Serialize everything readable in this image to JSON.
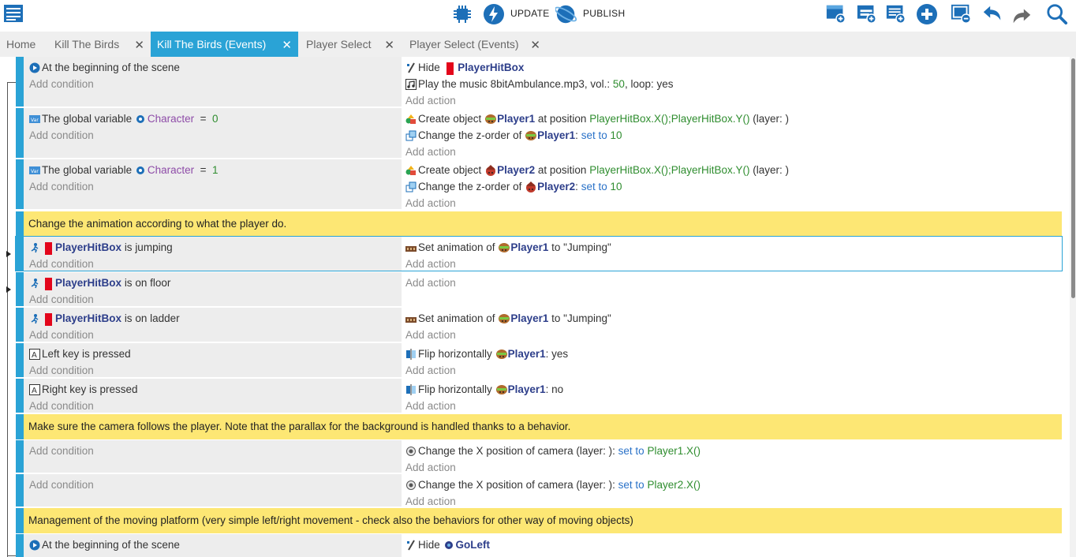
{
  "toolbar": {
    "update_label": "UPDATE",
    "publish_label": "PUBLISH"
  },
  "tabs": [
    {
      "label": "Home"
    },
    {
      "label": "Kill The Birds"
    },
    {
      "label": "Kill The Birds (Events)"
    },
    {
      "label": "Player Select"
    },
    {
      "label": "Player Select (Events)"
    }
  ],
  "tab_close": "✕",
  "colors": {
    "accent": "#2aa3d6",
    "comment_bg": "#fde774",
    "condition_bg": "#ededed",
    "object_text": "#2d3e8a",
    "value_text": "#2f8d2f"
  },
  "common": {
    "add_condition": "Add condition",
    "add_action": "Add action"
  },
  "events": {
    "e1": {
      "cond": "At the beginning of the scene",
      "a1_verb": "Hide",
      "a1_obj": "PlayerHitBox",
      "a2_pre": "Play the music",
      "a2_file": "8bitAmbulance.mp3, vol.:",
      "a2_vol": "50",
      "a2_post": ", loop: yes"
    },
    "e2": {
      "cond_pre": "The global variable",
      "cond_var": "Character",
      "cond_op": "=",
      "cond_val": "0",
      "a1_pre": "Create object",
      "a1_obj": "Player1",
      "a1_mid": "at position",
      "a1_expr": "PlayerHitBox.X();PlayerHitBox.Y()",
      "a1_post": "(layer: )",
      "a2_pre": "Change the z-order of",
      "a2_obj": "Player1",
      "a2_colon": ":",
      "a2_op": "set to",
      "a2_val": "10"
    },
    "e3": {
      "cond_pre": "The global variable",
      "cond_var": "Character",
      "cond_op": "=",
      "cond_val": "1",
      "a1_pre": "Create object",
      "a1_obj": "Player2",
      "a1_mid": "at position",
      "a1_expr": "PlayerHitBox.X();PlayerHitBox.Y()",
      "a1_post": "(layer: )",
      "a2_pre": "Change the z-order of",
      "a2_obj": "Player2",
      "a2_colon": ":",
      "a2_op": "set to",
      "a2_val": "10"
    },
    "c1": "Change the animation according to what the player do.",
    "e4": {
      "cond_obj": "PlayerHitBox",
      "cond_post": "is jumping",
      "a1_pre": "Set animation of",
      "a1_obj": "Player1",
      "a1_post": "to \"Jumping\""
    },
    "e5": {
      "cond_obj": "PlayerHitBox",
      "cond_post": "is on floor"
    },
    "e6": {
      "cond_obj": "PlayerHitBox",
      "cond_post": "is on ladder",
      "a1_pre": "Set animation of",
      "a1_obj": "Player1",
      "a1_post": "to \"Jumping\""
    },
    "e7": {
      "cond_key": "Left",
      "cond_post": "key is pressed",
      "a1_pre": "Flip horizontally",
      "a1_obj": "Player1",
      "a1_post": ": yes"
    },
    "e8": {
      "cond_key": "Right",
      "cond_post": "key is pressed",
      "a1_pre": "Flip horizontally",
      "a1_obj": "Player1",
      "a1_post": ": no"
    },
    "c2": "Make sure the camera follows the player. Note that the parallax for the background is handled thanks to a behavior.",
    "e9": {
      "a1_pre": "Change the X position of camera  (layer: ):",
      "a1_op": "set to",
      "a1_expr": "Player1.X()"
    },
    "e10": {
      "a1_pre": "Change the X position of camera  (layer: ):",
      "a1_op": "set to",
      "a1_expr": "Player2.X()"
    },
    "c3": "Management of the moving platform (very simple left/right movement - check also the behaviors for other way of moving objects)",
    "e11": {
      "cond": "At the beginning of the scene",
      "a1_verb": "Hide",
      "a1_obj": "GoLeft"
    }
  }
}
